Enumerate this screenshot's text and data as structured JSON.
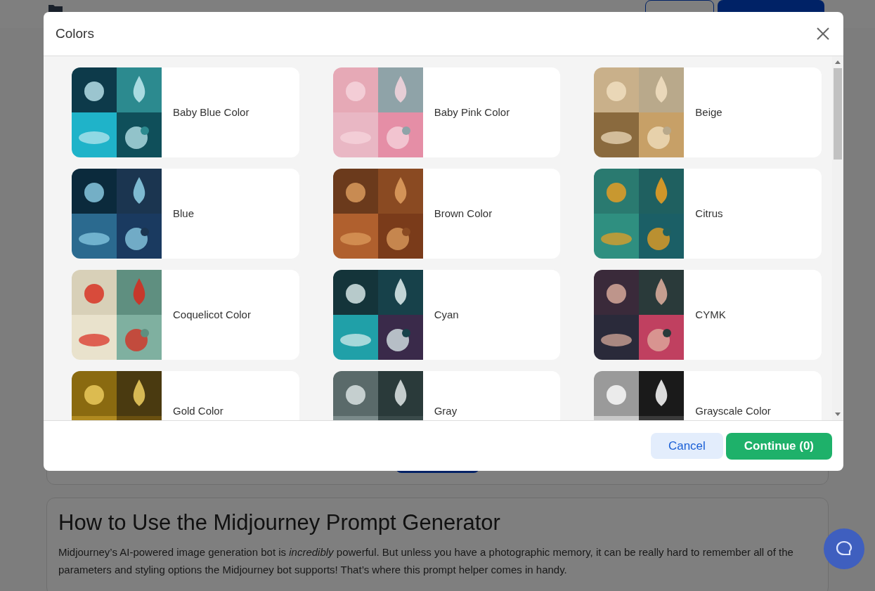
{
  "header": {
    "buttons": [
      {
        "kind": "outline"
      },
      {
        "kind": "filled"
      }
    ]
  },
  "guide": {
    "title": "How to Use the Midjourney Prompt Generator",
    "text": "Midjourney’s AI-powered image generation bot is *incredibly* powerful. But unless you have a photographic memory, it can be really hard to remember all of the parameters and styling options the Midjourney bot supports! That’s where this prompt helper comes in handy."
  },
  "dialog": {
    "title": "Colors",
    "options": [
      {
        "label": "Baby Blue Color",
        "selected": false
      },
      {
        "label": "Baby Pink Color",
        "selected": false
      },
      {
        "label": "Beige",
        "selected": false
      },
      {
        "label": "Blue",
        "selected": false
      },
      {
        "label": "Brown Color",
        "selected": false
      },
      {
        "label": "Citrus",
        "selected": false
      },
      {
        "label": "Coquelicot Color",
        "selected": false
      },
      {
        "label": "Cyan",
        "selected": false
      },
      {
        "label": "CYMK",
        "selected": false
      },
      {
        "label": "Gold Color",
        "selected": false
      },
      {
        "label": "Gray",
        "selected": false
      },
      {
        "label": "Grayscale Color",
        "selected": false
      }
    ],
    "cancel": "Cancel",
    "continue": "Continue (0)"
  }
}
